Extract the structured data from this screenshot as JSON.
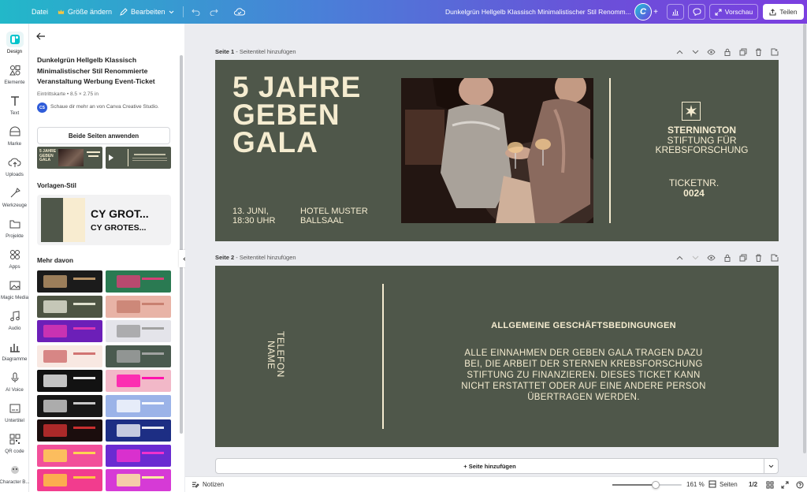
{
  "topbar": {
    "file": "Datei",
    "resize": "Größe ändern",
    "edit": "Bearbeiten",
    "doc_title": "Dunkelgrün Hellgelb Klassisch Minimalistischer Stil Renomm...",
    "preview": "Vorschau",
    "share": "Teilen",
    "avatar_letter": "C"
  },
  "rail": [
    {
      "label": "Design",
      "icon": "design-icon"
    },
    {
      "label": "Elemente",
      "icon": "elements-icon"
    },
    {
      "label": "Text",
      "icon": "text-icon"
    },
    {
      "label": "Marke",
      "icon": "brand-icon"
    },
    {
      "label": "Uploads",
      "icon": "upload-icon"
    },
    {
      "label": "Werkzeuge",
      "icon": "tools-icon"
    },
    {
      "label": "Projekte",
      "icon": "folder-icon"
    },
    {
      "label": "Apps",
      "icon": "apps-icon"
    },
    {
      "label": "Magic Media",
      "icon": "magic-media-icon"
    },
    {
      "label": "Audio",
      "icon": "audio-icon"
    },
    {
      "label": "Diagramme",
      "icon": "chart-icon"
    },
    {
      "label": "AI Voice",
      "icon": "ai-voice-icon"
    },
    {
      "label": "Untertitel",
      "icon": "subtitle-icon"
    },
    {
      "label": "QR code",
      "icon": "qr-icon"
    },
    {
      "label": "Character B...",
      "icon": "character-icon"
    }
  ],
  "panel": {
    "title_l1": "Dunkelgrün Hellgelb Klassisch",
    "title_l2": "Minimalistischer Stil Renommierte",
    "title_l3": "Veranstaltung Werbung Event-Ticket",
    "meta": "Eintrittskarte • 8.5 × 2.75 in",
    "creator_badge": "CS",
    "creator_text": "Schaue dir mehr an von Canva Creative Studio.",
    "apply_button": "Beide Seiten anwenden",
    "template_thumb_text": "5 JAHRE GEBEN GALA",
    "style_heading": "Vorlagen-Stil",
    "style_font_1": "CY GROT...",
    "style_font_2": "CY GROTES...",
    "more_heading": "Mehr davon"
  },
  "page1": {
    "header_prefix": "Seite 1",
    "header_suffix": " - Seitentitel hinzufügen",
    "title_l1": "5 JAHRE",
    "title_l2": "GEBEN",
    "title_l3": "GALA",
    "date_l1": "13. JUNI,",
    "date_l2": "18:30 UHR",
    "venue_l1": "HOTEL MUSTER",
    "venue_l2": "BALLSAAL",
    "org_l1": "STERNINGTON",
    "org_l2": "STIFTUNG FÜR",
    "org_l3": "KREBSFORSCHUNG",
    "ticket_label": "TICKETNR.",
    "ticket_no": "0024"
  },
  "page2": {
    "header_prefix": "Seite 2",
    "header_suffix": " - Seitentitel hinzufügen",
    "name_label": "NAME",
    "phone_label": "TELEFON",
    "terms_title": "ALLGEMEINE GESCHÄFTSBEDINGUNGEN",
    "terms_l1": "ALLE EINNAHMEN DER GEBEN GALA TRAGEN DAZU",
    "terms_l2": "BEI, DIE ARBEIT DER STERNEN KREBSFORSCHUNG",
    "terms_l3": "STIFTUNG ZU FINANZIEREN. DIESES TICKET KANN",
    "terms_l4": "NICHT ERSTATTET ODER AUF EINE ANDERE PERSON",
    "terms_l5": "ÜBERTRAGEN WERDEN."
  },
  "add_page": "+ Seite hinzufügen",
  "bottom": {
    "notes": "Notizen",
    "zoom": "161 %",
    "pages_label": "Seiten",
    "page_count": "1/2",
    "zoom_fraction": 0.62
  },
  "colors": {
    "ticket_green": "#4f574a",
    "cream": "#f5ecd0",
    "canva_purple": "#7b3fe0"
  }
}
